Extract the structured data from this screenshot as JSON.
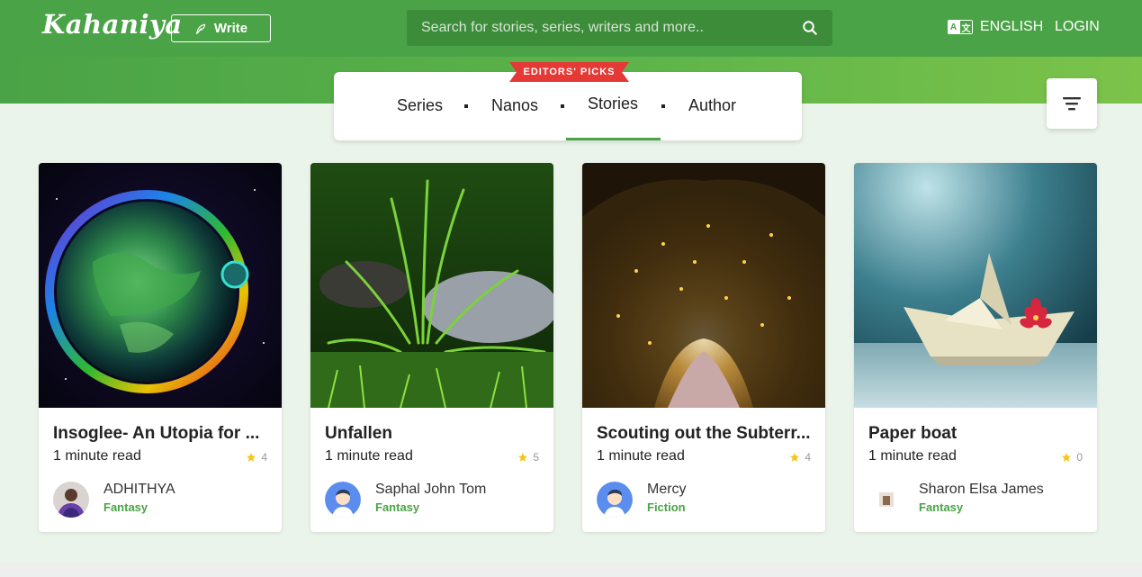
{
  "header": {
    "logo": "Kahaniya",
    "write_label": "Write",
    "search_placeholder": "Search for stories, series, writers and more..",
    "language_label": "ENGLISH",
    "login_label": "LOGIN"
  },
  "picks": {
    "ribbon": "EDITORS' PICKS",
    "tabs": [
      {
        "label": "Series"
      },
      {
        "label": "Nanos"
      },
      {
        "label": "Stories"
      },
      {
        "label": "Author"
      }
    ],
    "active_tab": "Stories"
  },
  "stories": [
    {
      "title": "Insoglee- An Utopia for ...",
      "read_time": "1 minute read",
      "rating": "4",
      "author": "ADHITHYA",
      "genre": "Fantasy"
    },
    {
      "title": "Unfallen",
      "read_time": "1 minute read",
      "rating": "5",
      "author": "Saphal John Tom",
      "genre": "Fantasy"
    },
    {
      "title": "Scouting out the Subterr...",
      "read_time": "1 minute read",
      "rating": "4",
      "author": "Mercy",
      "genre": "Fiction"
    },
    {
      "title": "Paper boat",
      "read_time": "1 minute read",
      "rating": "0",
      "author": "Sharon Elsa James",
      "genre": "Fantasy"
    }
  ],
  "colors": {
    "brand_green": "#4aa346",
    "ribbon_red": "#e53935",
    "star_yellow": "#f5c518"
  }
}
